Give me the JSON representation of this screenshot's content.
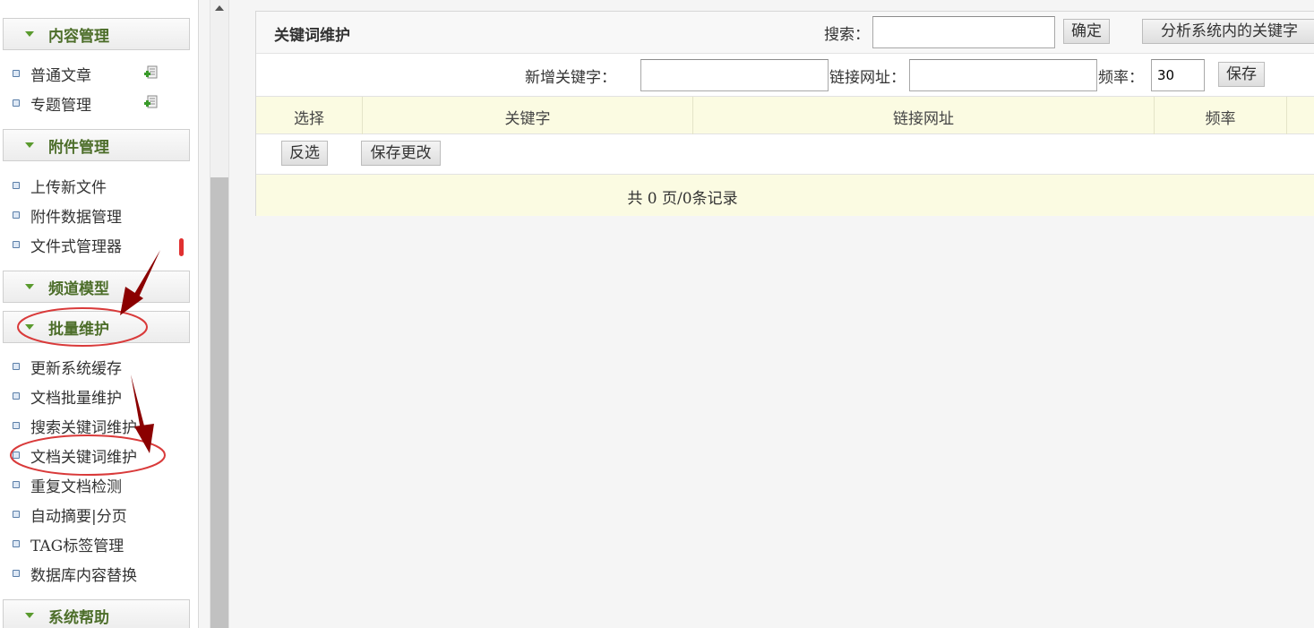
{
  "sidebar": {
    "groups": [
      {
        "title": "内容管理",
        "items": [
          "普通文章",
          "专题管理"
        ]
      },
      {
        "title": "附件管理",
        "items": [
          "上传新文件",
          "附件数据管理",
          "文件式管理器"
        ]
      },
      {
        "title": "频道模型",
        "items": []
      },
      {
        "title": "批量维护",
        "items": [
          "更新系统缓存",
          "文档批量维护",
          "搜索关键词维护",
          "文档关键词维护",
          "重复文档检测",
          "自动摘要|分页",
          "TAG标签管理",
          "数据库内容替换"
        ]
      },
      {
        "title": "系统帮助",
        "items": []
      }
    ],
    "icons": {
      "add": "add-document-icon",
      "bullet": "bullet-icon",
      "expand": "chevron-down-icon"
    }
  },
  "main": {
    "title": "关键词维护",
    "search_label": "搜索：",
    "search_value": "",
    "confirm_label": "确定",
    "analyze_label": "分析系统内的关键字",
    "new_keyword_label": "新增关键字：",
    "new_keyword_value": "",
    "link_label": "链接网址：",
    "link_value": "",
    "freq_label": "频率：",
    "freq_value": "30",
    "save_label": "保存",
    "columns": [
      "选择",
      "关键字",
      "链接网址",
      "频率"
    ],
    "invert_label": "反选",
    "save_changes_label": "保存更改",
    "pagination": "共 0 页/0条记录"
  },
  "colors": {
    "accent_green": "#4d6e2a",
    "header_row": "#fbfbe2",
    "annotation_red": "#d93a3a",
    "arrow_red": "#8b0000"
  }
}
